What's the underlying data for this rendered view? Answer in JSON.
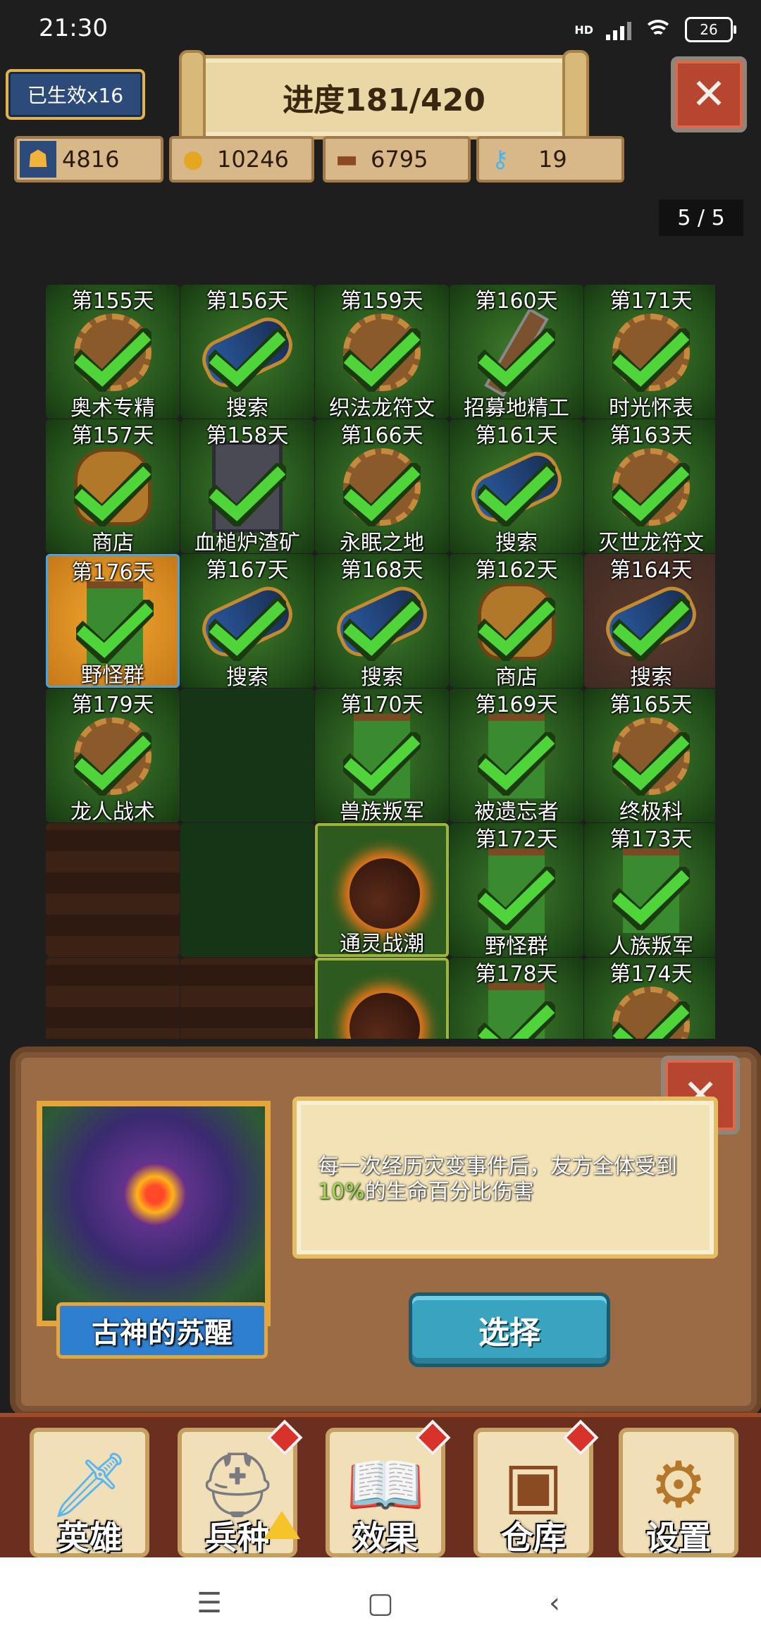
{
  "status_bar": {
    "time": "21:30",
    "network": "HD",
    "battery": "26"
  },
  "hud": {
    "effects_badge": "已生效x16",
    "progress": "进度181/420",
    "resources": [
      {
        "icon": "population-icon",
        "value": "4816"
      },
      {
        "icon": "gold-coins-icon",
        "value": "10246"
      },
      {
        "icon": "wood-logs-icon",
        "value": "6795"
      },
      {
        "icon": "crystal-key-icon",
        "value": "19"
      }
    ],
    "page_indicator": "5 / 5"
  },
  "grid": [
    {
      "day": "第155天",
      "name": "奥术专精",
      "icon": "gear-icon",
      "done": true
    },
    {
      "day": "第156天",
      "name": "搜索",
      "icon": "spyglass-icon",
      "done": true
    },
    {
      "day": "第159天",
      "name": "织法龙符文",
      "icon": "gear-icon",
      "done": true
    },
    {
      "day": "第160天",
      "name": "招募地精工",
      "icon": "axe-icon",
      "done": true
    },
    {
      "day": "第171天",
      "name": "时光怀表",
      "icon": "gear-icon",
      "done": true
    },
    {
      "day": "第157天",
      "name": "商店",
      "icon": "treasure-bag-icon",
      "done": true
    },
    {
      "day": "第158天",
      "name": "血槌炉渣矿",
      "icon": "tower-icon",
      "done": true
    },
    {
      "day": "第166天",
      "name": "永眠之地",
      "icon": "gear-icon",
      "done": true
    },
    {
      "day": "第161天",
      "name": "搜索",
      "icon": "spyglass-icon",
      "done": true
    },
    {
      "day": "第163天",
      "name": "灭世龙符文",
      "icon": "gear-icon",
      "done": true
    },
    {
      "day": "第176天",
      "name": "野怪群",
      "icon": "banner-icon",
      "done": true
    },
    {
      "day": "第167天",
      "name": "搜索",
      "icon": "spyglass-icon",
      "done": true
    },
    {
      "day": "第168天",
      "name": "搜索",
      "icon": "spyglass-icon",
      "done": true
    },
    {
      "day": "第162天",
      "name": "商店",
      "icon": "treasure-bag-icon",
      "done": true
    },
    {
      "day": "第164天",
      "name": "搜索",
      "icon": "spyglass-icon",
      "done": true
    },
    {
      "day": "第179天",
      "name": "龙人战术",
      "icon": "gear-icon",
      "done": true
    },
    {
      "day": "",
      "name": "",
      "icon": "",
      "done": false
    },
    {
      "day": "第170天",
      "name": "兽族叛军",
      "icon": "banner-icon",
      "done": true
    },
    {
      "day": "第169天",
      "name": "被遗忘者",
      "icon": "banner-icon",
      "done": true
    },
    {
      "day": "第165天",
      "name": "终极科",
      "icon": "gear-icon",
      "done": true
    },
    {
      "day": "",
      "name": "",
      "icon": "",
      "done": false
    },
    {
      "day": "",
      "name": "",
      "icon": "",
      "done": false
    },
    {
      "day": "",
      "name": "通灵战潮",
      "icon": "meteor-icon",
      "done": false
    },
    {
      "day": "第172天",
      "name": "野怪群",
      "icon": "banner-icon",
      "done": true
    },
    {
      "day": "第173天",
      "name": "人族叛军",
      "icon": "banner-icon",
      "done": true
    },
    {
      "day": "",
      "name": "",
      "icon": "",
      "done": false
    },
    {
      "day": "",
      "name": "",
      "icon": "",
      "done": false
    },
    {
      "day": "",
      "name": "",
      "icon": "meteor-icon",
      "done": false
    },
    {
      "day": "第178天",
      "name": "",
      "icon": "banner-icon",
      "done": true
    },
    {
      "day": "第174天",
      "name": "",
      "icon": "gear-icon",
      "done": true
    }
  ],
  "dialog": {
    "title": "古神的苏醒",
    "description_part1": "每一次经历灾变事件后，友方全体受到",
    "description_highlight": "10%",
    "description_part2": "的生命百分比伤害",
    "select_label": "选择"
  },
  "bottom_nav": [
    {
      "label": "英雄",
      "icon": "sword-icon"
    },
    {
      "label": "兵种",
      "icon": "helmet-icon"
    },
    {
      "label": "效果",
      "icon": "spellbook-icon"
    },
    {
      "label": "仓库",
      "icon": "treasure-chest-icon"
    },
    {
      "label": "设置",
      "icon": "gear-icon"
    }
  ]
}
